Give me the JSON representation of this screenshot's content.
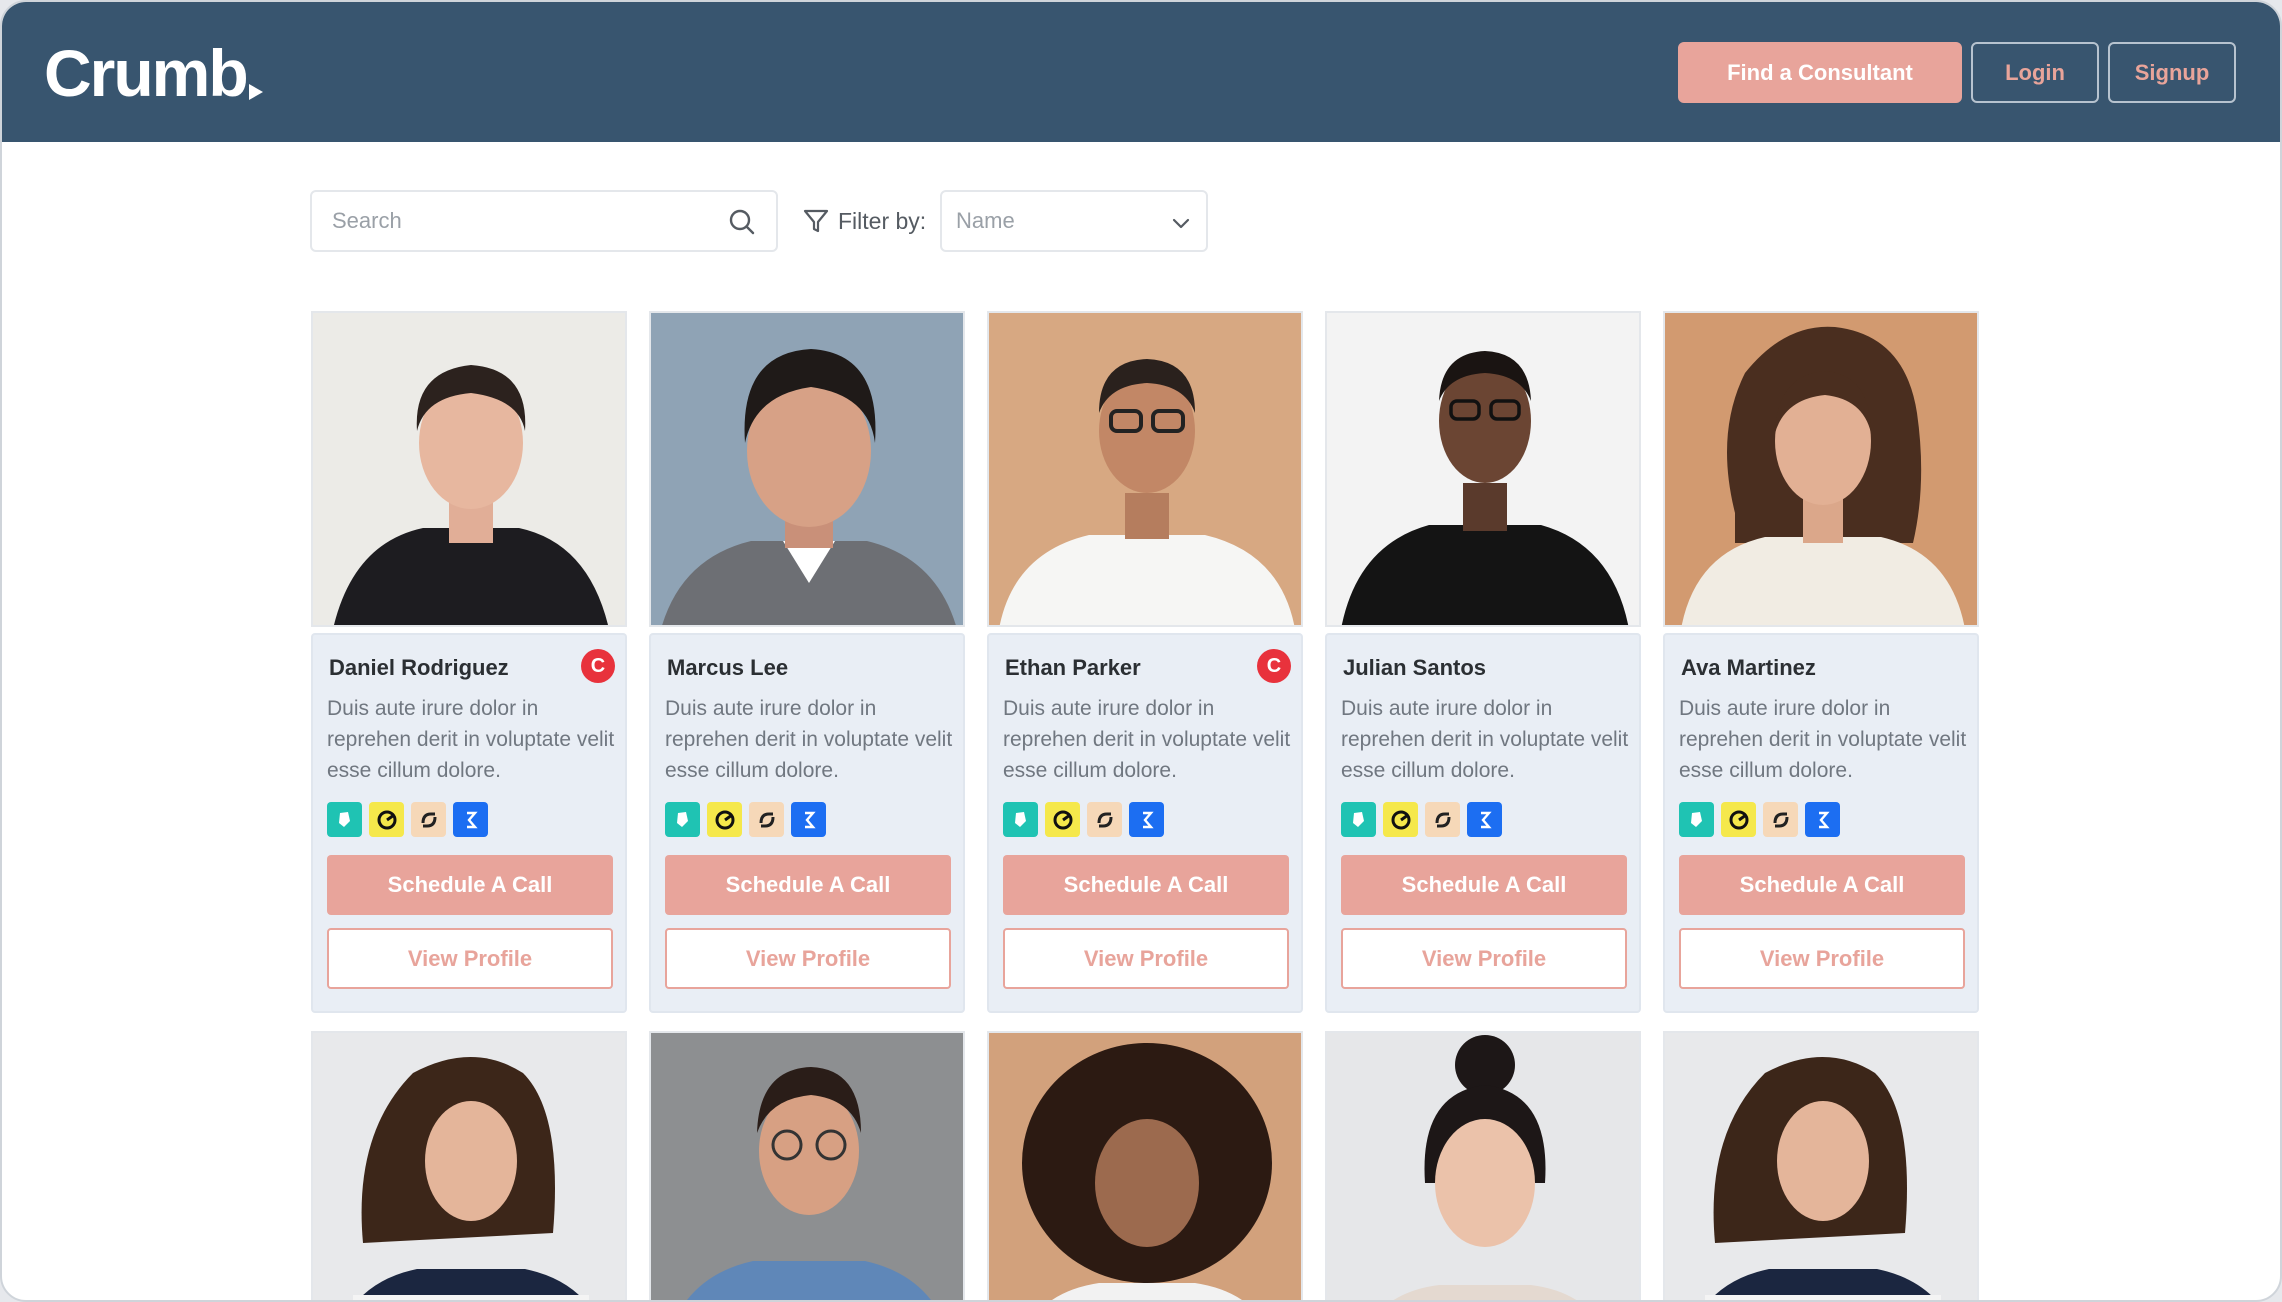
{
  "header": {
    "logo": "Crumb",
    "nav": {
      "find_label": "Find a Consultant",
      "login_label": "Login",
      "signup_label": "Signup"
    }
  },
  "toolbar": {
    "search_placeholder": "Search",
    "filter_label": "Filter by:",
    "filter_value": "Name"
  },
  "colors": {
    "header_bg": "#38556f",
    "accent": "#e8a49b",
    "card_bg": "#e9eef5",
    "badge": "#e8323c"
  },
  "consultants": [
    {
      "name": "Daniel Rodriguez",
      "description": "Duis aute irure dolor in reprehen derit in voluptate velit esse cillum dolore.",
      "badge": "C",
      "schedule_label": "Schedule A Call",
      "profile_label": "View Profile"
    },
    {
      "name": "Marcus Lee",
      "description": "Duis aute irure dolor in reprehen derit in voluptate velit esse cillum dolore.",
      "badge": "",
      "schedule_label": "Schedule A Call",
      "profile_label": "View Profile"
    },
    {
      "name": "Ethan Parker",
      "description": "Duis aute irure dolor in reprehen derit in voluptate velit esse cillum dolore.",
      "badge": "C",
      "schedule_label": "Schedule A Call",
      "profile_label": "View Profile"
    },
    {
      "name": "Julian Santos",
      "description": "Duis aute irure dolor in reprehen derit in voluptate velit esse cillum dolore.",
      "badge": "",
      "schedule_label": "Schedule A Call",
      "profile_label": "View Profile"
    },
    {
      "name": "Ava Martinez",
      "description": "Duis aute irure dolor in reprehen derit in voluptate velit esse cillum dolore.",
      "badge": "",
      "schedule_label": "Schedule A Call",
      "profile_label": "View Profile"
    }
  ],
  "tool_icons": [
    "deliveroo-icon",
    "swirl-logo-icon",
    "loop-logo-icon",
    "bracket-logo-icon"
  ]
}
